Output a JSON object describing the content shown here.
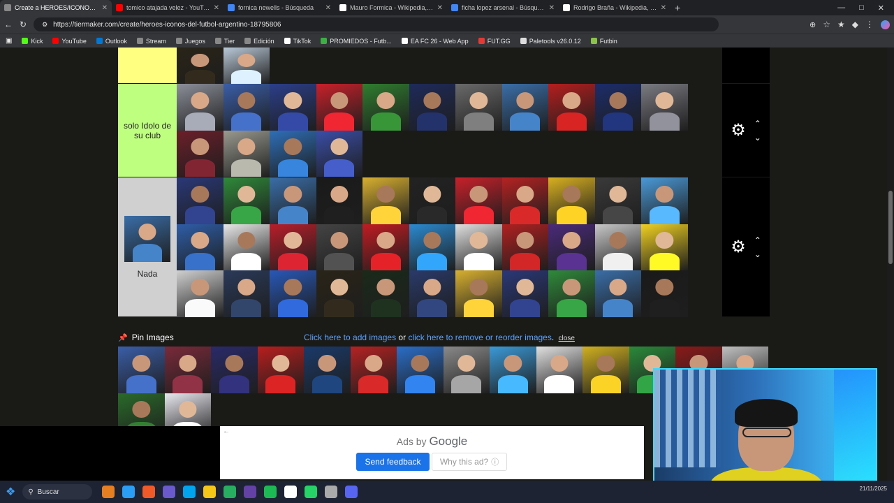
{
  "browser": {
    "tabs": [
      {
        "title": "Create a HEROES/ICONOS del FU",
        "color": "#888888",
        "active": true
      },
      {
        "title": "tomico atajada velez - YouTube",
        "color": "#ff0000",
        "active": false
      },
      {
        "title": "fornica newells - Búsqueda",
        "color": "#4285f4",
        "active": false
      },
      {
        "title": "Mauro Formica - Wikipedia, la enc",
        "color": "#ffffff",
        "active": false
      },
      {
        "title": "ficha lopez arsenal - Búsqueda",
        "color": "#4285f4",
        "active": false
      },
      {
        "title": "Rodrigo Braña - Wikipedia, la enc",
        "color": "#ffffff",
        "active": false
      }
    ],
    "new_tab": "+",
    "url": "https://tiermaker.com/create/heroes-iconos-del-futbol-argentino-18795806",
    "bookmarks": [
      {
        "label": "Kick",
        "color": "#53fc18"
      },
      {
        "label": "YouTube",
        "color": "#ff0000"
      },
      {
        "label": "Outlook",
        "color": "#0078d4"
      },
      {
        "label": "Stream",
        "color": "#888888"
      },
      {
        "label": "Juegos",
        "color": "#888888"
      },
      {
        "label": "Tier",
        "color": "#888888"
      },
      {
        "label": "Edición",
        "color": "#888888"
      },
      {
        "label": "TikTok",
        "color": "#ffffff"
      },
      {
        "label": "PROMIEDOS - Futb...",
        "color": "#3cb043"
      },
      {
        "label": "EA FC 26 - Web App",
        "color": "#ffffff"
      },
      {
        "label": "FUT.GG",
        "color": "#e53935"
      },
      {
        "label": "Paletools v26.0.12",
        "color": "#dddddd"
      },
      {
        "label": "Futbin",
        "color": "#8bc34a"
      }
    ]
  },
  "tiers": [
    {
      "label": "",
      "color": "#ffff80",
      "count": 2,
      "palette": [
        "#2a2418",
        "#b9c9d8"
      ]
    },
    {
      "label": "solo Idolo de su club",
      "color": "#bfff7f",
      "count": 15,
      "palette": [
        "#8c8f9a",
        "#3a5ea8",
        "#2b3e8a",
        "#c8202a",
        "#2f7d2f",
        "#1e2a5a",
        "#6a6a6a",
        "#3a6ea8",
        "#b51e1e",
        "#1c2c6a",
        "#7a7a82",
        "#6c1f2a",
        "#9a9a90",
        "#2e6fb8",
        "#3a4ea8"
      ]
    },
    {
      "label": "Nada",
      "color": "#d0d0d0",
      "count": 33,
      "palette": [
        "#2a3878",
        "#2f8a3a",
        "#3a6ea8",
        "#1a1a1a",
        "#d8b030",
        "#222222",
        "#c8202a",
        "#b52222",
        "#d8b020",
        "#3a3a3a",
        "#4a9ad8",
        "#2e5ea8",
        "#e8e8e8",
        "#b81e2a",
        "#444444",
        "#c01c22",
        "#2a8ad0",
        "#e0e0e0",
        "#b02020",
        "#4a2a7a",
        "#c8c8c8",
        "#f0d020",
        "#d0d0d0",
        "#2a3a5a",
        "#2858b8",
        "#2a2418",
        "#1a2a1a",
        "#2a3a6a",
        "#d8b030"
      ]
    }
  ],
  "tier_controls": {
    "settings_icon": "gear-icon",
    "up_icon": "chevron-up-icon",
    "down_icon": "chevron-down-icon"
  },
  "pin": {
    "title": "Pin Images",
    "add_text": "Click here to add images",
    "or_text": "or",
    "remove_text": "click here to remove or reorder images",
    "period": ".",
    "close": "close"
  },
  "pool": {
    "count": 16,
    "palette": [
      "#3a5ea8",
      "#7a2a3a",
      "#2a2a6a",
      "#b81e1e",
      "#1a3a6a",
      "#b52222",
      "#2a6ec8",
      "#8a8a8a",
      "#3a9ad8",
      "#e0e0e0",
      "#d0b020",
      "#2a8a3a",
      "#8a1a1a",
      "#c0c0c0",
      "#2a6a2a",
      "#e8e8f0"
    ]
  },
  "ad": {
    "ads_by": "Ads by",
    "brand": "Google",
    "send_feedback": "Send feedback",
    "why": "Why this ad?"
  },
  "taskbar": {
    "search": "Buscar",
    "time": "",
    "date": "21/11/2025",
    "apps": [
      "#e67e22",
      "#2a9df4",
      "#f05a28",
      "#6a5acd",
      "#00a4ef",
      "#f5c518",
      "#27ae60",
      "#6441a5",
      "#1db954",
      "#ffffff",
      "#25d366",
      "#aaaaaa",
      "#5865f2"
    ]
  }
}
